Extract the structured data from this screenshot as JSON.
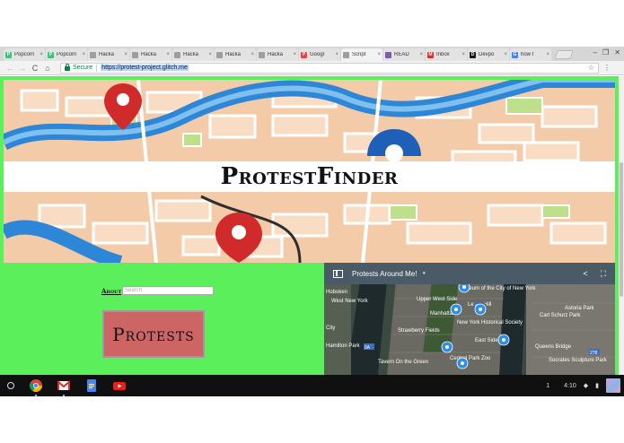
{
  "browser": {
    "tabs": [
      {
        "label": "Popcorn",
        "favicon_color": "#3ec373",
        "favicon_glyph": "P",
        "active": false
      },
      {
        "label": "Popcorn",
        "favicon_color": "#3ec373",
        "favicon_glyph": "P",
        "active": false
      },
      {
        "label": "Hacka",
        "favicon_color": "#9e9e9e",
        "favicon_glyph": "",
        "active": false
      },
      {
        "label": "Hacka",
        "favicon_color": "#9e9e9e",
        "favicon_glyph": "",
        "active": false
      },
      {
        "label": "Hacka",
        "favicon_color": "#9e9e9e",
        "favicon_glyph": "",
        "active": false
      },
      {
        "label": "Hacka",
        "favicon_color": "#9e9e9e",
        "favicon_glyph": "",
        "active": false
      },
      {
        "label": "Hacka",
        "favicon_color": "#9e9e9e",
        "favicon_glyph": "",
        "active": false
      },
      {
        "label": "Googl",
        "favicon_color": "#e8453c",
        "favicon_glyph": "P",
        "active": false
      },
      {
        "label": "Script",
        "favicon_color": "#9e9e9e",
        "favicon_glyph": "",
        "active": true
      },
      {
        "label": "READ",
        "favicon_color": "#7b5ea7",
        "favicon_glyph": "",
        "active": false
      },
      {
        "label": "Inbox",
        "favicon_color": "#d93025",
        "favicon_glyph": "M",
        "active": false
      },
      {
        "label": "Devpo",
        "favicon_color": "#1a1a1a",
        "favicon_glyph": "D",
        "active": false
      },
      {
        "label": "how t",
        "favicon_color": "#4285f4",
        "favicon_glyph": "G",
        "active": false
      }
    ],
    "tab_close_glyph": "×",
    "window_controls": {
      "minimize": "–",
      "restore": "❐",
      "close": "✕"
    },
    "nav": {
      "back": "←",
      "forward": "→",
      "reload": "C",
      "home": "⌂"
    },
    "secure_label": "Secure",
    "url": "https://protest-project.glitch.me",
    "star_icon": "☆",
    "menu_icon": "⋮"
  },
  "page": {
    "site_title": "ProtestFinder",
    "about_label": "About",
    "search_placeholder": "Search",
    "protests_button_label": "Protests",
    "map": {
      "title": "Protests Around Me!",
      "info_glyph": "●",
      "share_glyph": "<",
      "fullscreen_glyph": "⛶",
      "place_labels": [
        "Hoboken",
        "West New York",
        "Museum of the City of New York",
        "Upper West Side",
        "Manhattan",
        "New York Historical Society",
        "Strawberry Fields",
        "East Side",
        "Lenox Hill",
        "Carl Schurz Park",
        "Astoria Park",
        "Central Park Zoo",
        "Socrates Sculpture Park",
        "Hamilton Park",
        "Tavern On the Green",
        "Queens Bridge",
        "City"
      ],
      "road_labels": [
        "495",
        "9A",
        "278"
      ]
    },
    "accent_green": "#5bef5b",
    "button_color": "#cd6565"
  },
  "shelf": {
    "apps": [
      "chrome-icon",
      "gmail-icon",
      "docs-icon",
      "youtube-icon"
    ],
    "notification_count": "1",
    "time": "4:10",
    "wifi_glyph": "◆",
    "battery_glyph": "▮"
  }
}
